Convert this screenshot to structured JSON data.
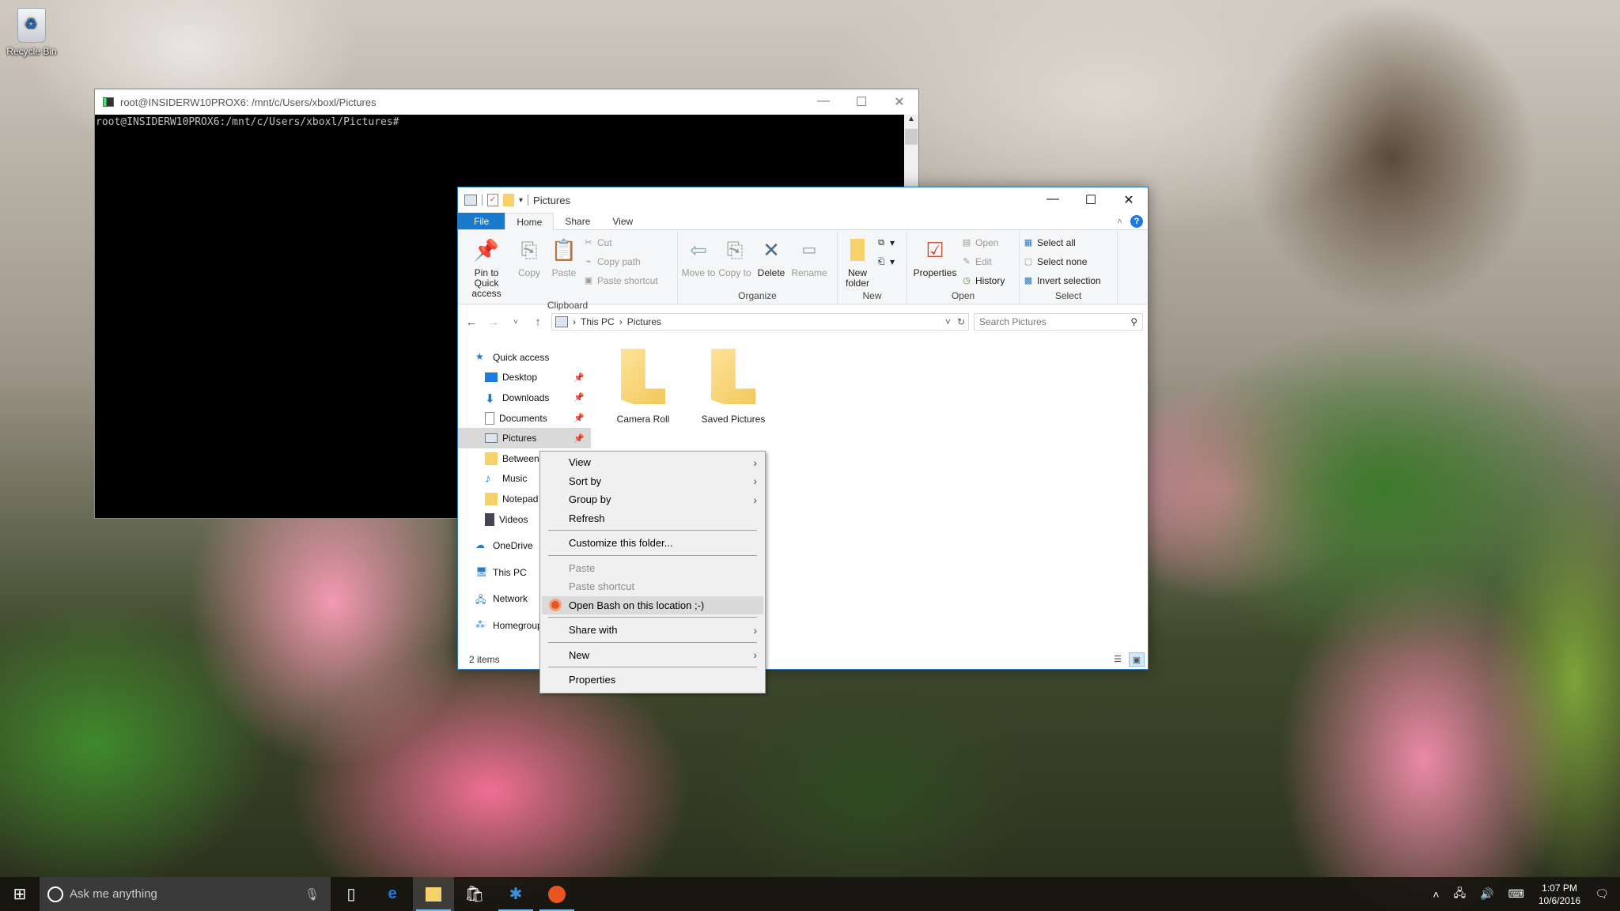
{
  "desktop": {
    "recycle_bin_label": "Recycle Bin"
  },
  "terminal": {
    "title": "root@INSIDERW10PROX6: /mnt/c/Users/xboxl/Pictures",
    "prompt": "root@INSIDERW10PROX6:/mnt/c/Users/xboxl/Pictures#",
    "controls": {
      "minimize": "—",
      "maximize": "☐",
      "close": "✕"
    }
  },
  "explorer": {
    "title": "Pictures",
    "controls": {
      "minimize": "—",
      "maximize": "☐",
      "close": "✕"
    },
    "tabs": [
      {
        "label": "File"
      },
      {
        "label": "Home"
      },
      {
        "label": "Share"
      },
      {
        "label": "View"
      }
    ],
    "ribbon": {
      "clipboard": {
        "label": "Clipboard",
        "pin": "Pin to Quick access",
        "copy": "Copy",
        "paste": "Paste",
        "cut": "Cut",
        "copy_path": "Copy path",
        "paste_shortcut": "Paste shortcut"
      },
      "organize": {
        "label": "Organize",
        "move_to": "Move to",
        "copy_to": "Copy to",
        "delete": "Delete",
        "rename": "Rename"
      },
      "new": {
        "label": "New",
        "new_folder": "New folder"
      },
      "open": {
        "label": "Open",
        "properties": "Properties",
        "open": "Open",
        "edit": "Edit",
        "history": "History"
      },
      "select": {
        "label": "Select",
        "select_all": "Select all",
        "select_none": "Select none",
        "invert": "Invert selection"
      }
    },
    "address": {
      "path": [
        "This PC",
        "Pictures"
      ],
      "search_placeholder": "Search Pictures"
    },
    "nav": [
      {
        "label": "Quick access",
        "level": 1
      },
      {
        "label": "Desktop",
        "level": 2,
        "pinned": true
      },
      {
        "label": "Downloads",
        "level": 2,
        "pinned": true
      },
      {
        "label": "Documents",
        "level": 2,
        "pinned": true
      },
      {
        "label": "Pictures",
        "level": 2,
        "pinned": true,
        "selected": true
      },
      {
        "label": "Between",
        "level": 2
      },
      {
        "label": "Music",
        "level": 2
      },
      {
        "label": "Notepad",
        "level": 2
      },
      {
        "label": "Videos",
        "level": 2
      },
      {
        "label": "OneDrive",
        "level": 1
      },
      {
        "label": "This PC",
        "level": 1
      },
      {
        "label": "Network",
        "level": 1
      },
      {
        "label": "Homegroup",
        "level": 1
      }
    ],
    "items": [
      {
        "name": "Camera Roll"
      },
      {
        "name": "Saved Pictures"
      }
    ],
    "status": "2 items"
  },
  "context_menu": {
    "items": [
      {
        "label": "View",
        "submenu": true
      },
      {
        "label": "Sort by",
        "submenu": true
      },
      {
        "label": "Group by",
        "submenu": true
      },
      {
        "label": "Refresh"
      },
      {
        "label": "Customize this folder..."
      },
      {
        "label": "Paste",
        "disabled": true
      },
      {
        "label": "Paste shortcut",
        "disabled": true
      },
      {
        "label": "Open Bash on this location ;-)",
        "highlighted": true
      },
      {
        "label": "Share with",
        "submenu": true
      },
      {
        "label": "New",
        "submenu": true
      },
      {
        "label": "Properties"
      }
    ]
  },
  "taskbar": {
    "search_placeholder": "Ask me anything",
    "time": "1:07 PM",
    "date": "10/6/2016"
  },
  "colors": {
    "accent": "#1979ca",
    "ubuntu": "#e95420",
    "taskbar": "#161410"
  }
}
